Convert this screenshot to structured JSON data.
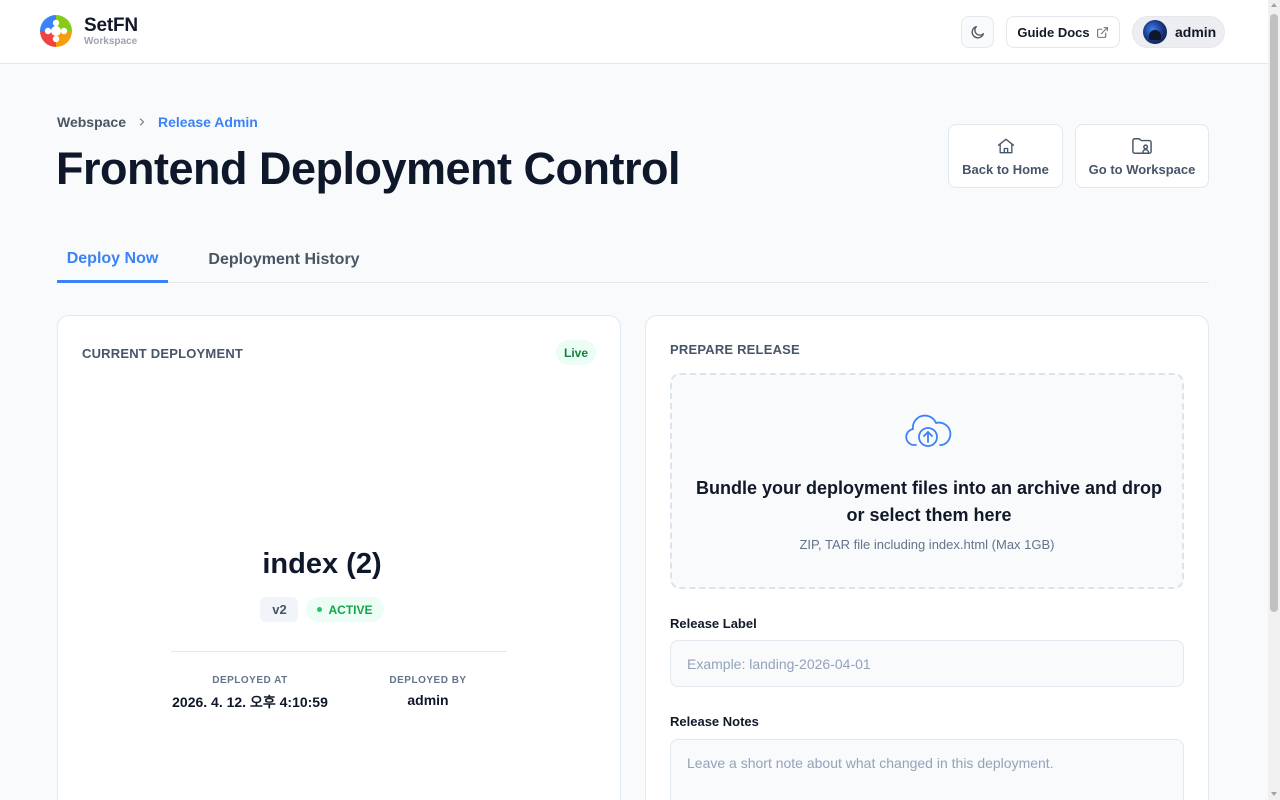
{
  "app": {
    "brand_name": "SetFN",
    "brand_sub": "Workspace"
  },
  "header": {
    "guide_docs_label": "Guide Docs",
    "user_name": "admin"
  },
  "breadcrumb": {
    "items": [
      "Webspace",
      "Release Admin"
    ]
  },
  "page": {
    "title": "Frontend Deployment Control",
    "back_home_label": "Back to Home",
    "go_workspace_label": "Go to Workspace"
  },
  "tabs": {
    "deploy_now": "Deploy Now",
    "deployment_history": "Deployment History",
    "active": "Deploy Now"
  },
  "current_deployment": {
    "section_label": "CURRENT DEPLOYMENT",
    "live_badge": "Live",
    "name": "index (2)",
    "version": "v2",
    "status": "ACTIVE",
    "deployed_at_label": "DEPLOYED AT",
    "deployed_at": "2026. 4. 12. 오후 4:10:59",
    "deployed_by_label": "DEPLOYED BY",
    "deployed_by": "admin"
  },
  "prepare_release": {
    "section_label": "PREPARE RELEASE",
    "drop_title": "Bundle your deployment files into an archive and drop or select them here",
    "drop_hint": "ZIP, TAR file including index.html (Max 1GB)",
    "release_label_title": "Release Label",
    "release_label_placeholder": "Example: landing-2026-04-01",
    "release_label_value": "",
    "release_notes_title": "Release Notes",
    "release_notes_placeholder": "Leave a short note about what changed in this deployment.",
    "release_notes_value": ""
  },
  "colors": {
    "accent": "#3b82f6",
    "live_green": "#15803d",
    "title": "#0f172a"
  },
  "icons": {
    "theme": "moon-icon",
    "guide_external": "external-link-icon",
    "home": "home-icon",
    "workspace": "folder-user-icon",
    "upload": "cloud-upload-icon",
    "breadcrumb_separator": "chevron-right-icon"
  }
}
